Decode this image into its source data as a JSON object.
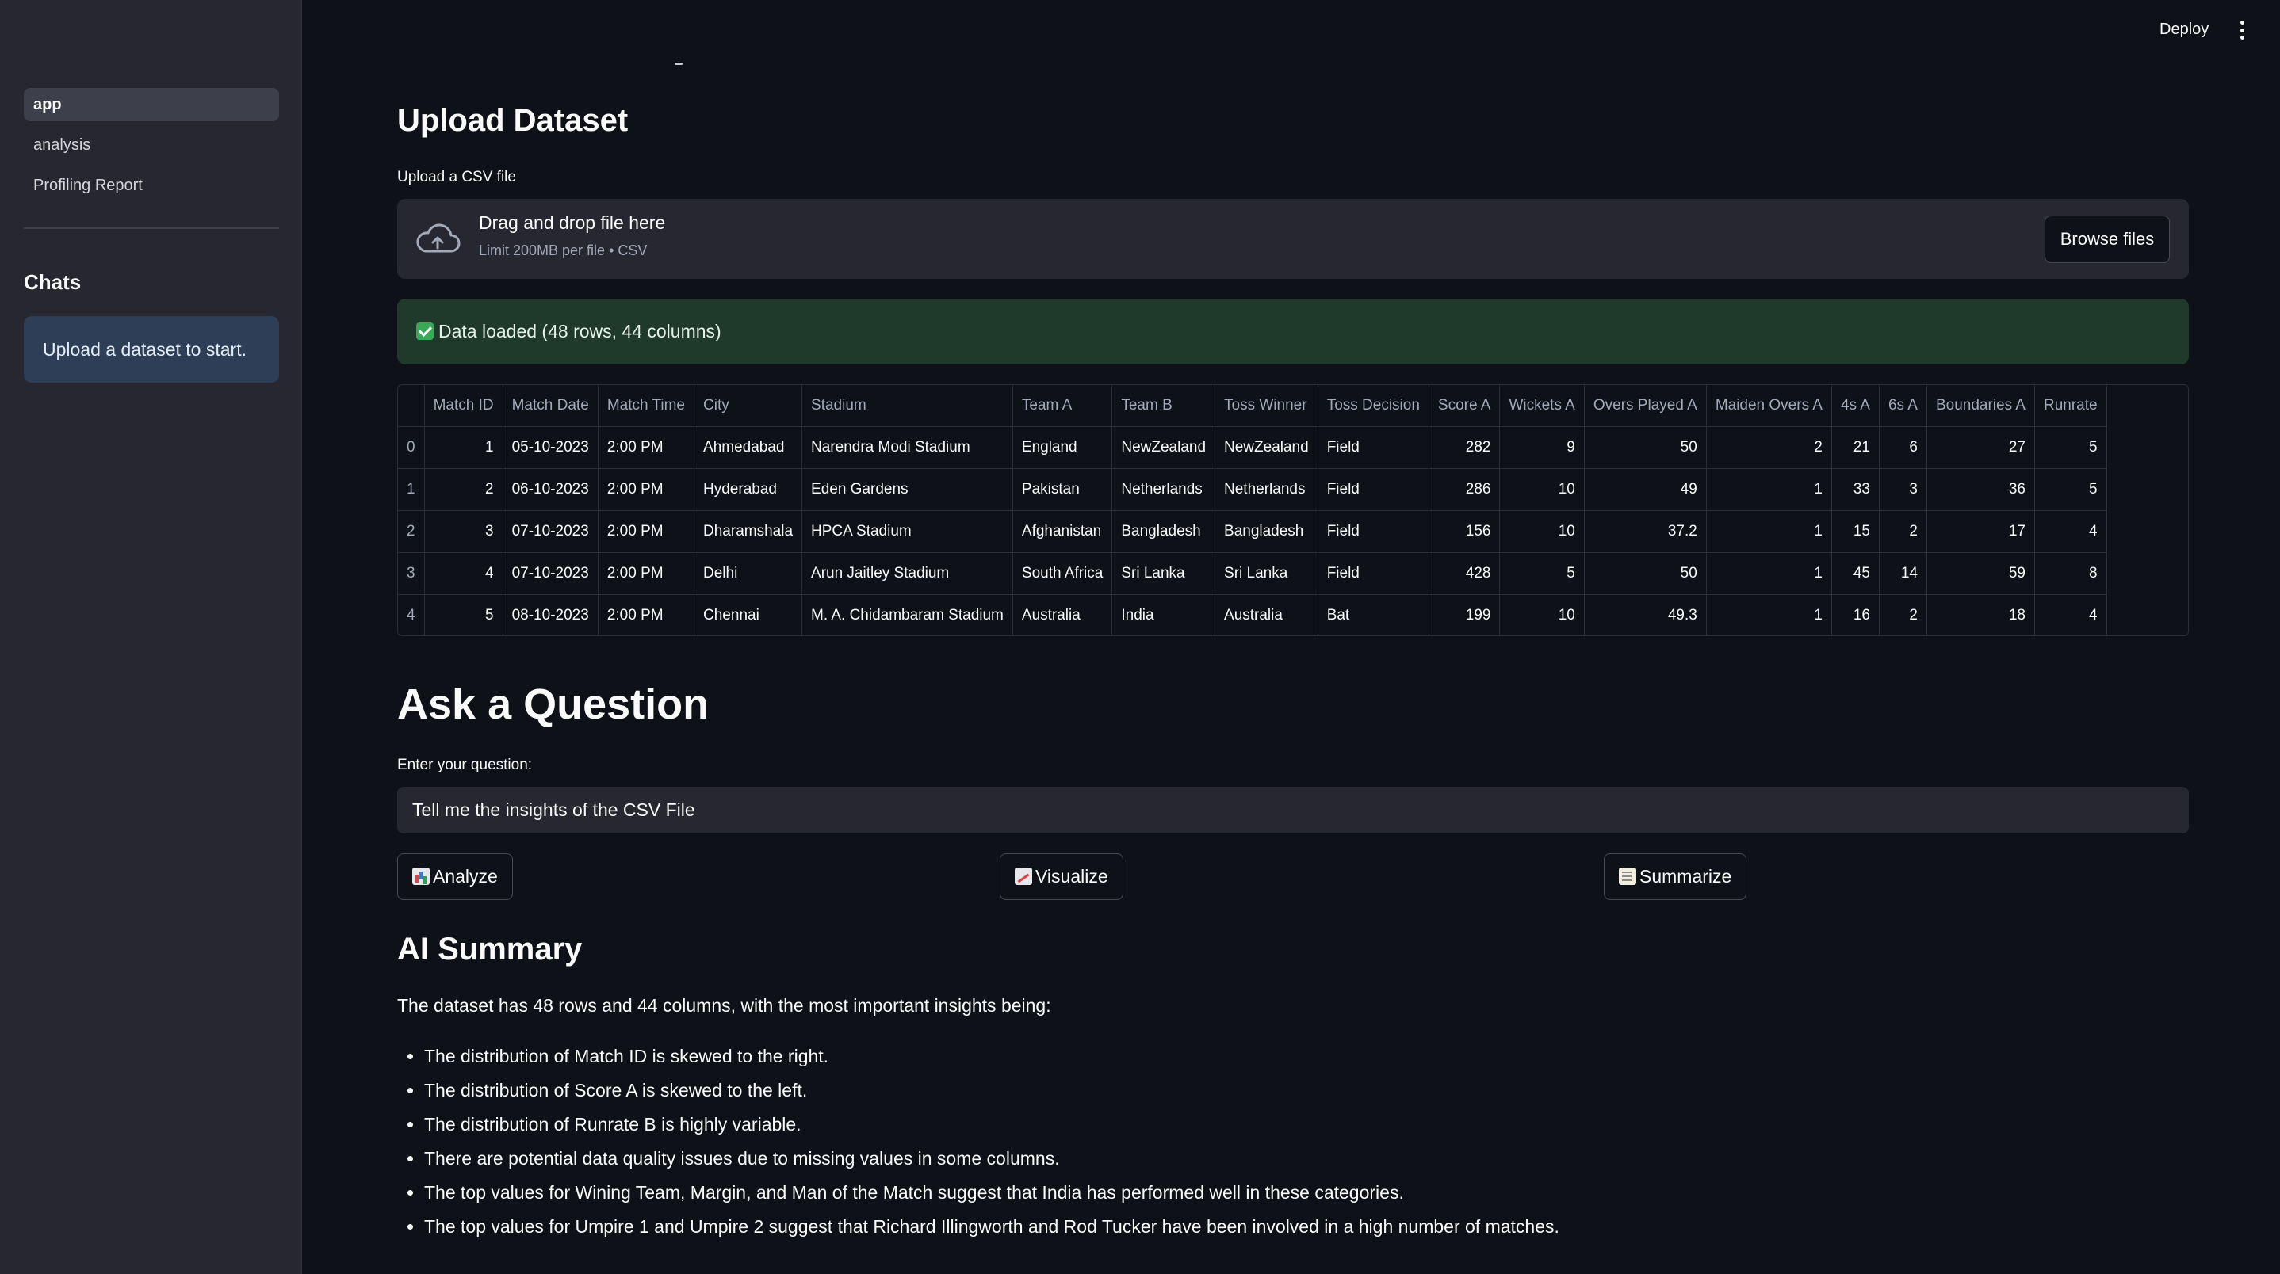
{
  "sidebar": {
    "nav": [
      "app",
      "analysis",
      "Profiling Report"
    ],
    "chats_title": "Chats",
    "chats_info": "Upload a dataset to start."
  },
  "header": {
    "deploy_label": "Deploy"
  },
  "upload": {
    "title": "Upload Dataset",
    "label": "Upload a CSV file",
    "drop_title": "Drag and drop file here",
    "drop_limit": "Limit 200MB per file • CSV",
    "browse_label": "Browse files",
    "success": "Data loaded (48 rows, 44 columns)"
  },
  "table": {
    "columns": [
      "",
      "Match ID",
      "Match Date",
      "Match Time",
      "City",
      "Stadium",
      "Team A",
      "Team B",
      "Toss Winner",
      "Toss Decision",
      "Score A",
      "Wickets A",
      "Overs Played A",
      "Maiden Overs A",
      "4s A",
      "6s A",
      "Boundaries A",
      "Runrate"
    ],
    "rows": [
      [
        "0",
        "1",
        "05-10-2023",
        "2:00 PM",
        "Ahmedabad",
        "Narendra Modi Stadium",
        "England",
        "NewZealand",
        "NewZealand",
        "Field",
        "282",
        "9",
        "50",
        "2",
        "21",
        "6",
        "27",
        "5"
      ],
      [
        "1",
        "2",
        "06-10-2023",
        "2:00 PM",
        "Hyderabad",
        "Eden Gardens",
        "Pakistan",
        "Netherlands",
        "Netherlands",
        "Field",
        "286",
        "10",
        "49",
        "1",
        "33",
        "3",
        "36",
        "5"
      ],
      [
        "2",
        "3",
        "07-10-2023",
        "2:00 PM",
        "Dharamshala",
        "HPCA Stadium",
        "Afghanistan",
        "Bangladesh",
        "Bangladesh",
        "Field",
        "156",
        "10",
        "37.2",
        "1",
        "15",
        "2",
        "17",
        "4"
      ],
      [
        "3",
        "4",
        "07-10-2023",
        "2:00 PM",
        "Delhi",
        "Arun Jaitley Stadium",
        "South Africa",
        "Sri Lanka",
        "Sri Lanka",
        "Field",
        "428",
        "5",
        "50",
        "1",
        "45",
        "14",
        "59",
        "8"
      ],
      [
        "4",
        "5",
        "08-10-2023",
        "2:00 PM",
        "Chennai",
        "M. A. Chidambaram Stadium",
        "Australia",
        "India",
        "Australia",
        "Bat",
        "199",
        "10",
        "49.3",
        "1",
        "16",
        "2",
        "18",
        "4"
      ]
    ]
  },
  "ask": {
    "title": "Ask a Question",
    "label": "Enter your question:",
    "question": "Tell me the insights of the CSV File",
    "buttons": {
      "analyze": "Analyze",
      "visualize": "Visualize",
      "summarize": "Summarize"
    }
  },
  "summary": {
    "title": "AI Summary",
    "intro": "The dataset has 48 rows and 44 columns, with the most important insights being:",
    "points": [
      "The distribution of Match ID is skewed to the right.",
      "The distribution of Score A is skewed to the left.",
      "The distribution of Runrate B is highly variable.",
      "There are potential data quality issues due to missing values in some columns.",
      "The top values for Wining Team, Margin, and Man of the Match suggest that India has performed well in these categories.",
      "The top values for Umpire 1 and Umpire 2 suggest that Richard Illingworth and Rod Tucker have been involved in a high number of matches."
    ]
  }
}
